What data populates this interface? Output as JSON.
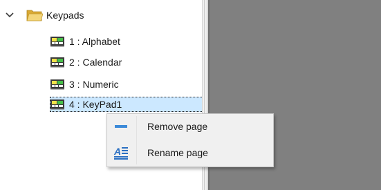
{
  "tree": {
    "root": {
      "label": "Keypads",
      "expanded": true
    },
    "items": [
      {
        "label": "1 : Alphabet",
        "selected": false
      },
      {
        "label": "2 : Calendar",
        "selected": false
      },
      {
        "label": "3 : Numeric",
        "selected": false
      },
      {
        "label": "4 : KeyPad1",
        "selected": true
      }
    ]
  },
  "context_menu": {
    "items": [
      {
        "label": "Remove page",
        "icon": "minus-icon"
      },
      {
        "label": "Rename page",
        "icon": "rename-icon"
      }
    ]
  },
  "colors": {
    "selection": "#cce8ff",
    "canvas": "#808080",
    "folder": "#e8c25a",
    "icon_blue": "#3c8ad8"
  }
}
